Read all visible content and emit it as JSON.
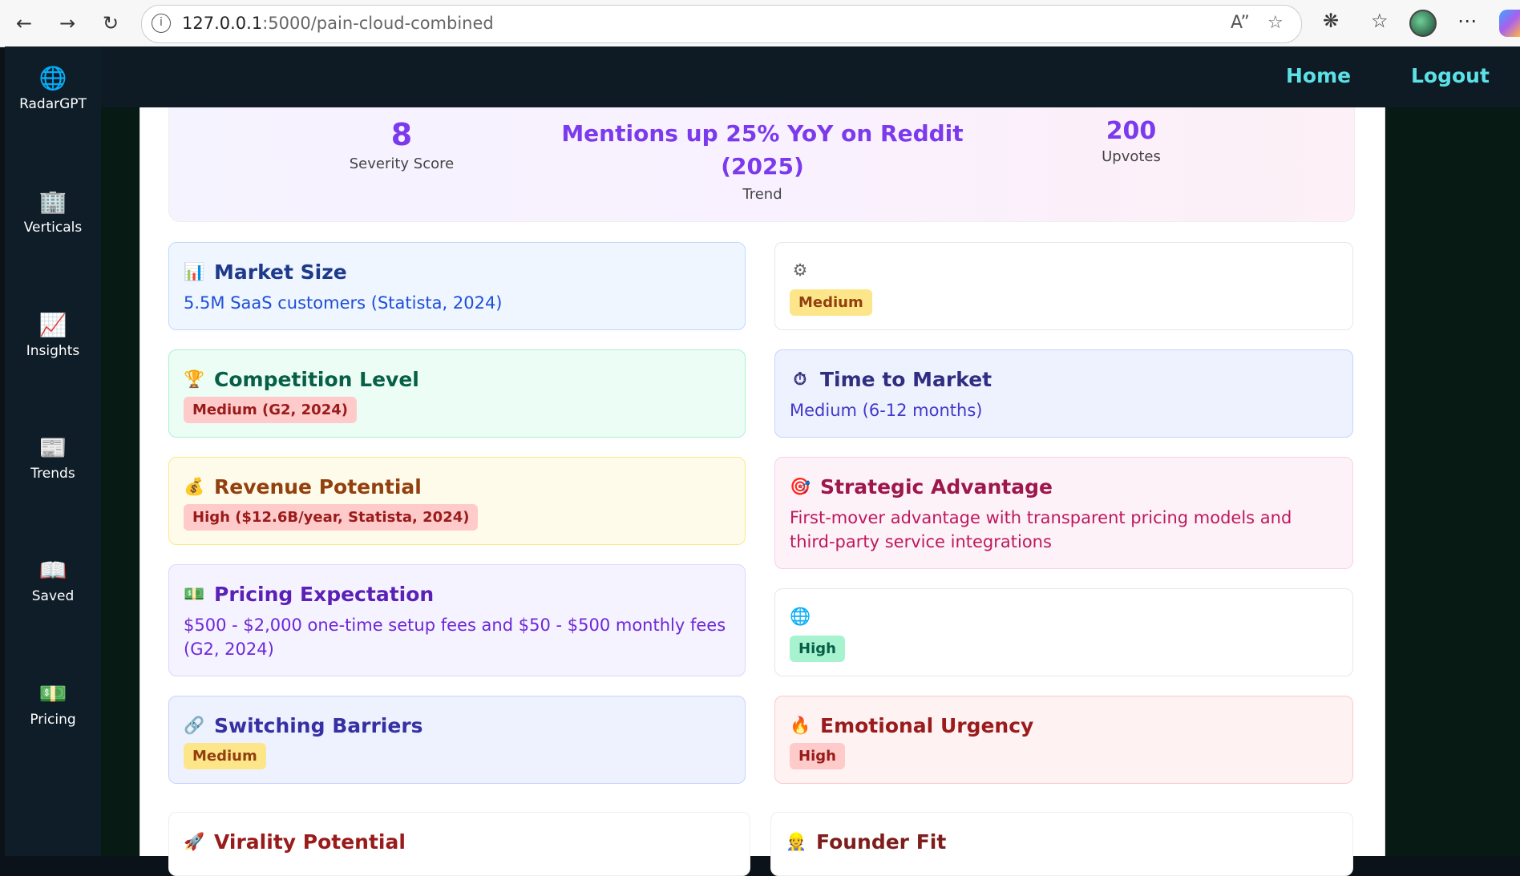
{
  "browser": {
    "url_host": "127.0.0.1",
    "url_path": ":5000/pain-cloud-combined"
  },
  "sidebar": {
    "items": [
      {
        "label": "RadarGPT",
        "icon": "globe-icon"
      },
      {
        "label": "Verticals",
        "icon": "building-icon"
      },
      {
        "label": "Insights",
        "icon": "chart-icon"
      },
      {
        "label": "Trends",
        "icon": "newspaper-icon"
      },
      {
        "label": "Saved",
        "icon": "book-icon"
      },
      {
        "label": "Pricing",
        "icon": "money-icon"
      }
    ]
  },
  "topnav": {
    "home": "Home",
    "logout": "Logout"
  },
  "stats": {
    "severity_value": "8",
    "severity_label": "Severity Score",
    "trend_value_line1": "Mentions up 25% YoY on Reddit",
    "trend_value_line2": "(2025)",
    "trend_label": "Trend",
    "upvotes_value": "200",
    "upvotes_label": "Upvotes"
  },
  "cards": {
    "market_size": {
      "icon": "📊",
      "title": "Market Size",
      "text": "5.5M SaaS customers (Statista, 2024)"
    },
    "gear": {
      "icon": "⚙",
      "badge": "Medium"
    },
    "competition": {
      "icon": "🏆",
      "title": "Competition Level",
      "badge": "Medium (G2, 2024)"
    },
    "time_to_market": {
      "icon": "⏱",
      "title": "Time to Market",
      "text": "Medium (6-12 months)"
    },
    "revenue": {
      "icon": "💰",
      "title": "Revenue Potential",
      "badge": "High ($12.6B/year, Statista, 2024)"
    },
    "strategic": {
      "icon": "🎯",
      "title": "Strategic Advantage",
      "text_line1": "First-mover advantage with transparent pricing models and",
      "text_line2": "third-party service integrations"
    },
    "pricing": {
      "icon": "💵",
      "title": "Pricing Expectation",
      "text_line1": "$500 - $2,000 one-time setup fees and $50 - $500 monthly fees",
      "text_line2": "(G2, 2024)"
    },
    "globe": {
      "icon": "🌐",
      "badge": "High"
    },
    "switching": {
      "icon": "🔗",
      "title": "Switching Barriers",
      "badge": "Medium"
    },
    "emotional": {
      "icon": "🔥",
      "title": "Emotional Urgency",
      "badge": "High"
    },
    "virality": {
      "icon": "🚀",
      "title": "Virality Potential"
    },
    "founder": {
      "icon": "👷",
      "title": "Founder Fit"
    }
  }
}
